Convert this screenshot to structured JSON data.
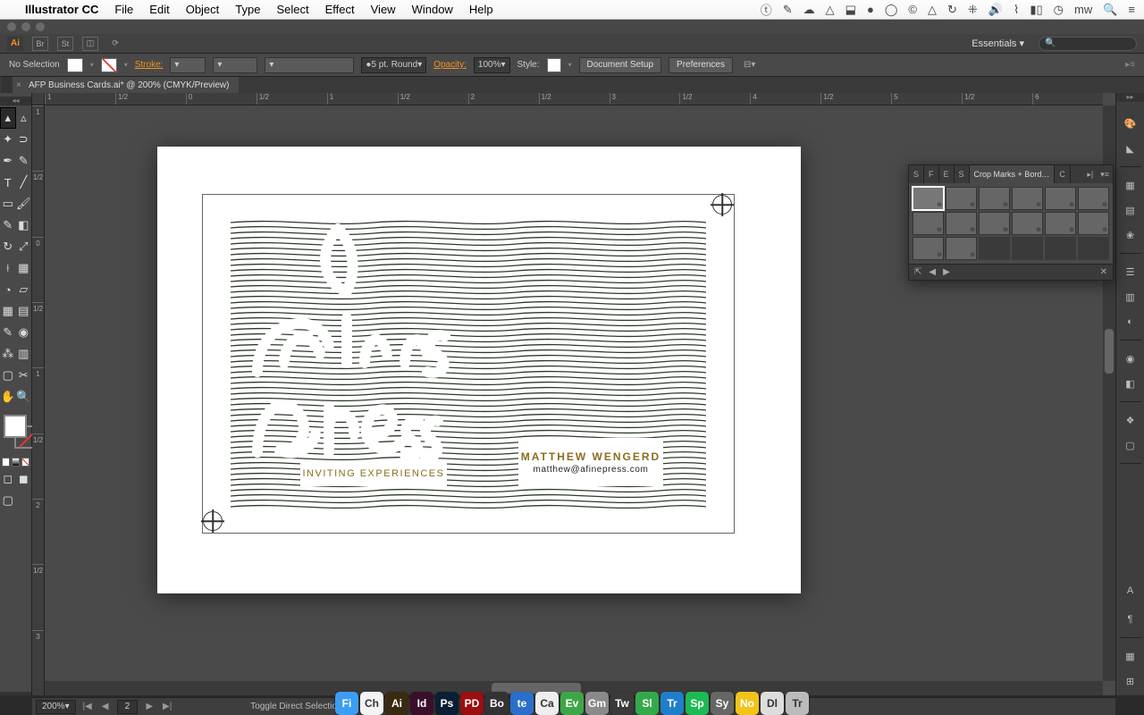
{
  "macmenu": {
    "app": "Illustrator CC",
    "items": [
      "File",
      "Edit",
      "Object",
      "Type",
      "Select",
      "Effect",
      "View",
      "Window",
      "Help"
    ],
    "user": "mw"
  },
  "workspace": {
    "label": "Essentials"
  },
  "controlbar": {
    "selection": "No Selection",
    "stroke_label": "Stroke:",
    "brush_preset": "5 pt. Round",
    "opacity_label": "Opacity:",
    "opacity_value": "100%",
    "style_label": "Style:",
    "doc_setup": "Document Setup",
    "preferences": "Preferences"
  },
  "document": {
    "tab_title": "AFP Business Cards.ai* @ 200% (CMYK/Preview)"
  },
  "ruler_h": [
    "1",
    "1/2",
    "0",
    "1/2",
    "1",
    "1/2",
    "2",
    "1/2",
    "3",
    "1/2",
    "4",
    "1/2",
    "5",
    "1/2",
    "6"
  ],
  "ruler_v": [
    "1",
    "1/2",
    "0",
    "1/2",
    "1",
    "1/2",
    "2",
    "1/2",
    "3"
  ],
  "card": {
    "tagline": "INVITING EXPERIENCES",
    "name": "MATTHEW WENGERD",
    "email": "matthew@afinepress.com",
    "script_alt": "a fine press (handwritten script logo)"
  },
  "panel": {
    "tab_short": [
      "S",
      "F",
      "E",
      "S"
    ],
    "tab_active": "Crop Marks + Bord…",
    "tab_c": "C",
    "artboard_count": 14
  },
  "statusbar": {
    "zoom": "200%",
    "artboard": "2",
    "hint": "Toggle Direct Selection"
  },
  "colors": {
    "accent_orange": "#f7931e",
    "card_gold": "#8a6d1f",
    "wave_green": "#2e3b2a"
  },
  "dock_apps": [
    {
      "label": "Finder",
      "bg": "#3b9ef2"
    },
    {
      "label": "Chrome",
      "bg": "#f4f4f4"
    },
    {
      "label": "Ai",
      "bg": "#3a2a12"
    },
    {
      "label": "Id",
      "bg": "#3a0f2a"
    },
    {
      "label": "Ps",
      "bg": "#0a1f33"
    },
    {
      "label": "PDF",
      "bg": "#9a0f12"
    },
    {
      "label": "Box",
      "bg": "#333"
    },
    {
      "label": "te",
      "bg": "#2a6fc9"
    },
    {
      "label": "Cal",
      "bg": "#eee"
    },
    {
      "label": "Ev",
      "bg": "#3fa648"
    },
    {
      "label": "Gm",
      "bg": "#8a8a8a"
    },
    {
      "label": "Tw",
      "bg": "#3a3a3a"
    },
    {
      "label": "Sl",
      "bg": "#35a94a"
    },
    {
      "label": "Tr",
      "bg": "#1f7fc9"
    },
    {
      "label": "Sp",
      "bg": "#1db954"
    },
    {
      "label": "Sy",
      "bg": "#666"
    },
    {
      "label": "No",
      "bg": "#f0c419"
    },
    {
      "label": "Dl",
      "bg": "#ddd"
    },
    {
      "label": "Tr",
      "bg": "#bbb"
    }
  ]
}
